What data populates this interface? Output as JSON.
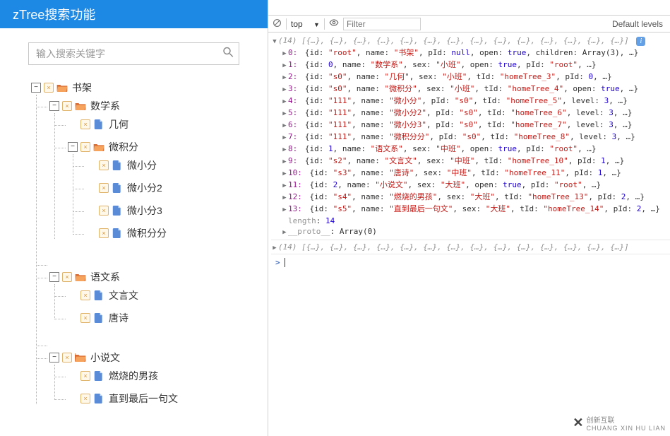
{
  "header": {
    "title": "zTree搜索功能"
  },
  "search": {
    "placeholder": "输入搜索关键字"
  },
  "tree": {
    "root": {
      "label": "书架"
    },
    "math": {
      "label": "数学系"
    },
    "geometry": {
      "label": "几何"
    },
    "calculus": {
      "label": "微积分"
    },
    "wxf1": {
      "label": "微小分"
    },
    "wxf2": {
      "label": "微小分2"
    },
    "wxf3": {
      "label": "微小分3"
    },
    "wjff": {
      "label": "微积分分"
    },
    "chinese": {
      "label": "语文系"
    },
    "wyw": {
      "label": "文言文"
    },
    "ts": {
      "label": "唐诗"
    },
    "novel": {
      "label": "小说文"
    },
    "boy": {
      "label": "燃烧的男孩"
    },
    "last": {
      "label": "直到最后一句文"
    }
  },
  "devtools": {
    "context": "top",
    "filter_placeholder": "Filter",
    "levels": "Default levels",
    "array_header": "(14)",
    "array_preview": "[{…}, {…}, {…}, {…}, {…}, {…}, {…}, {…}, {…}, {…}, {…}, {…}, {…}, {…}]",
    "length_label": "length",
    "length_value": "14",
    "proto_label": "__proto__",
    "proto_value": "Array(0)"
  },
  "console_rows": [
    {
      "i": "0",
      "body": "{id: |str:\"root\"|, name: |str:\"书架\"|, pId: |kw:null|, open: |kw:true|, children: Array(3), …}"
    },
    {
      "i": "1",
      "body": "{id: |num:0|, name: |str:\"数学系\"|, sex: |str:\"小班\"|, open: |kw:true|, pId: |str:\"root\"|, …}"
    },
    {
      "i": "2",
      "body": "{id: |str:\"s0\"|, name: |str:\"几何\"|, sex: |str:\"小班\"|, tId: |str:\"homeTree_3\"|, pId: |num:0|, …}"
    },
    {
      "i": "3",
      "body": "{id: |str:\"s0\"|, name: |str:\"微积分\"|, sex: |str:\"小班\"|, tId: |str:\"homeTree_4\"|, open: |kw:true|, …}"
    },
    {
      "i": "4",
      "body": "{id: |str:\"111\"|, name: |str:\"微小分\"|, pId: |str:\"s0\"|, tId: |str:\"homeTree_5\"|, level: |num:3|, …}"
    },
    {
      "i": "5",
      "body": "{id: |str:\"111\"|, name: |str:\"微小分2\"|, pId: |str:\"s0\"|, tId: |str:\"homeTree_6\"|, level: |num:3|, …}"
    },
    {
      "i": "6",
      "body": "{id: |str:\"111\"|, name: |str:\"微小分3\"|, pId: |str:\"s0\"|, tId: |str:\"homeTree_7\"|, level: |num:3|, …}"
    },
    {
      "i": "7",
      "body": "{id: |str:\"111\"|, name: |str:\"微积分分\"|, pId: |str:\"s0\"|, tId: |str:\"homeTree_8\"|, level: |num:3|, …}"
    },
    {
      "i": "8",
      "body": "{id: |num:1|, name: |str:\"语文系\"|, sex: |str:\"中班\"|, open: |kw:true|, pId: |str:\"root\"|, …}"
    },
    {
      "i": "9",
      "body": "{id: |str:\"s2\"|, name: |str:\"文言文\"|, sex: |str:\"中班\"|, tId: |str:\"homeTree_10\"|, pId: |num:1|, …}"
    },
    {
      "i": "10",
      "body": "{id: |str:\"s3\"|, name: |str:\"唐诗\"|, sex: |str:\"中班\"|, tId: |str:\"homeTree_11\"|, pId: |num:1|, …}"
    },
    {
      "i": "11",
      "body": "{id: |num:2|, name: |str:\"小说文\"|, sex: |str:\"大班\"|, open: |kw:true|, pId: |str:\"root\"|, …}"
    },
    {
      "i": "12",
      "body": "{id: |str:\"s4\"|, name: |str:\"燃烧的男孩\"|, sex: |str:\"大班\"|, tId: |str:\"homeTree_13\"|, pId: |num:2|, …}"
    },
    {
      "i": "13",
      "body": "{id: |str:\"s5\"|, name: |str:\"直到最后一句文\"|, sex: |str:\"大班\"|, tId: |str:\"homeTree_14\"|, pId: |num:2|, …}"
    }
  ],
  "watermark": {
    "brand": "创新互联",
    "sub": "CHUANG XIN HU LIAN"
  }
}
